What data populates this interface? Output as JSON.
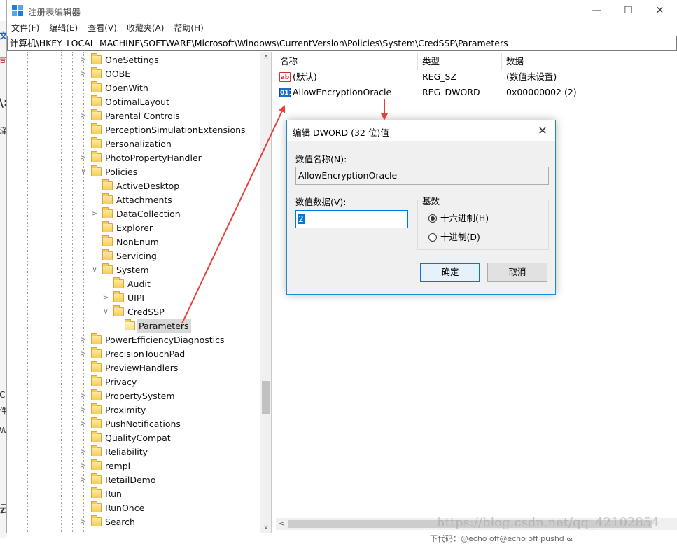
{
  "window": {
    "title": "注册表编辑器",
    "minimize_glyph": "—",
    "maximize_glyph": "☐",
    "close_glyph": "✕"
  },
  "menu": [
    "文件(F)",
    "编辑(E)",
    "查看(V)",
    "收藏夹(A)",
    "帮助(H)"
  ],
  "address": "计算机\\HKEY_LOCAL_MACHINE\\SOFTWARE\\Microsoft\\Windows\\CurrentVersion\\Policies\\System\\CredSSP\\Parameters",
  "background_fragments": [
    "司",
    "文",
    "\\:",
    "泽",
    "Cr",
    "件",
    "W",
    "云"
  ],
  "tree": [
    {
      "label": "OneSettings",
      "expandable": true,
      "level": 0
    },
    {
      "label": "OOBE",
      "expandable": true,
      "level": 0
    },
    {
      "label": "OpenWith",
      "expandable": false,
      "level": 0
    },
    {
      "label": "OptimalLayout",
      "expandable": false,
      "level": 0
    },
    {
      "label": "Parental Controls",
      "expandable": true,
      "level": 0
    },
    {
      "label": "PerceptionSimulationExtensions",
      "expandable": false,
      "level": 0
    },
    {
      "label": "Personalization",
      "expandable": false,
      "level": 0
    },
    {
      "label": "PhotoPropertyHandler",
      "expandable": true,
      "level": 0
    },
    {
      "label": "Policies",
      "expandable": true,
      "expanded": true,
      "level": 0
    },
    {
      "label": "ActiveDesktop",
      "expandable": false,
      "level": 1
    },
    {
      "label": "Attachments",
      "expandable": false,
      "level": 1
    },
    {
      "label": "DataCollection",
      "expandable": true,
      "level": 1
    },
    {
      "label": "Explorer",
      "expandable": false,
      "level": 1
    },
    {
      "label": "NonEnum",
      "expandable": false,
      "level": 1
    },
    {
      "label": "Servicing",
      "expandable": false,
      "level": 1
    },
    {
      "label": "System",
      "expandable": true,
      "expanded": true,
      "level": 1
    },
    {
      "label": "Audit",
      "expandable": false,
      "level": 2
    },
    {
      "label": "UIPI",
      "expandable": true,
      "level": 2
    },
    {
      "label": "CredSSP",
      "expandable": true,
      "expanded": true,
      "level": 2
    },
    {
      "label": "Parameters",
      "expandable": false,
      "level": 3,
      "selected": true
    },
    {
      "label": "PowerEfficiencyDiagnostics",
      "expandable": true,
      "level": 0
    },
    {
      "label": "PrecisionTouchPad",
      "expandable": true,
      "level": 0
    },
    {
      "label": "PreviewHandlers",
      "expandable": false,
      "level": 0
    },
    {
      "label": "Privacy",
      "expandable": false,
      "level": 0
    },
    {
      "label": "PropertySystem",
      "expandable": true,
      "level": 0
    },
    {
      "label": "Proximity",
      "expandable": true,
      "level": 0
    },
    {
      "label": "PushNotifications",
      "expandable": true,
      "level": 0
    },
    {
      "label": "QualityCompat",
      "expandable": false,
      "level": 0
    },
    {
      "label": "Reliability",
      "expandable": true,
      "level": 0
    },
    {
      "label": "rempl",
      "expandable": true,
      "level": 0
    },
    {
      "label": "RetailDemo",
      "expandable": true,
      "level": 0
    },
    {
      "label": "Run",
      "expandable": false,
      "level": 0
    },
    {
      "label": "RunOnce",
      "expandable": false,
      "level": 0
    },
    {
      "label": "Search",
      "expandable": true,
      "level": 0
    }
  ],
  "list": {
    "headers": [
      "名称",
      "类型",
      "数据"
    ],
    "rows": [
      {
        "icon": "string-value-icon",
        "icon_text": "ab",
        "name": "(默认)",
        "type": "REG_SZ",
        "data": "(数值未设置)"
      },
      {
        "icon": "binary-value-icon",
        "icon_text": "011",
        "name": "AllowEncryptionOracle",
        "type": "REG_DWORD",
        "data": "0x00000002 (2)"
      }
    ]
  },
  "dialog": {
    "title": "编辑 DWORD (32 位)值",
    "value_name_label": "数值名称(N):",
    "value_name": "AllowEncryptionOracle",
    "value_data_label": "数值数据(V):",
    "value_data": "2",
    "base_label": "基数",
    "hex_label": "十六进制(H)",
    "dec_label": "十进制(D)",
    "selected_base": "hex",
    "ok_label": "确定",
    "cancel_label": "取消"
  },
  "scroll_glyphs": {
    "up": "∧",
    "down": "∨",
    "left": "<"
  },
  "watermark": "https://blog.csdn.net/qq_42102854",
  "footer_fragment": "下代码：@echo off@echo off pushd &",
  "colors": {
    "accent": "#0078d7",
    "annotation_arrow": "#e8403a",
    "folder": "#f6cd57"
  }
}
